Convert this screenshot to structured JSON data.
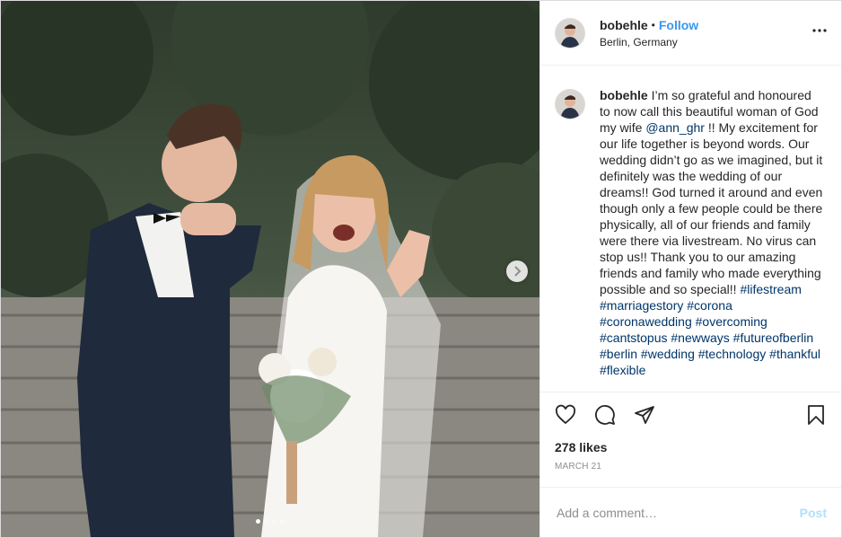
{
  "header": {
    "username": "bobehle",
    "separator": "•",
    "follow_label": "Follow",
    "location": "Berlin, Germany",
    "more_icon": "more-horizontal-icon"
  },
  "caption": {
    "username": "bobehle",
    "text_1": "I’m so grateful and honoured to now call this beautiful woman of God my wife",
    "mention": "@ann_ghr",
    "text_2": "!! My excitement for our life together is beyond words. Our wedding didn’t go as we imagined, but it definitely was the wedding of our dreams!! God turned it around and even though only a few people could be there physically, all of our friends and family were there via livestream. No virus can stop us!! Thank you to our amazing friends and family who made everything possible and so special!!",
    "hashtags": [
      "#lifestream",
      "#marriagestory",
      "#corona",
      "#coronawedding",
      "#overcoming",
      "#cantstopus",
      "#newways",
      "#futureofberlin",
      "#berlin",
      "#wedding",
      "#technology",
      "#thankful",
      "#flexible"
    ]
  },
  "media": {
    "carousel_total": 4,
    "carousel_active": 1,
    "next_icon": "chevron-right-icon"
  },
  "actions": {
    "like_icon": "heart-icon",
    "comment_icon": "comment-icon",
    "share_icon": "share-icon",
    "save_icon": "bookmark-icon"
  },
  "likes_text": "278 likes",
  "date_text": "MARCH 21",
  "comment_box": {
    "placeholder": "Add a comment…",
    "post_label": "Post"
  },
  "colors": {
    "link_blue": "#3897f0",
    "hashtag": "#003569",
    "post_disabled": "#b2dffc"
  }
}
